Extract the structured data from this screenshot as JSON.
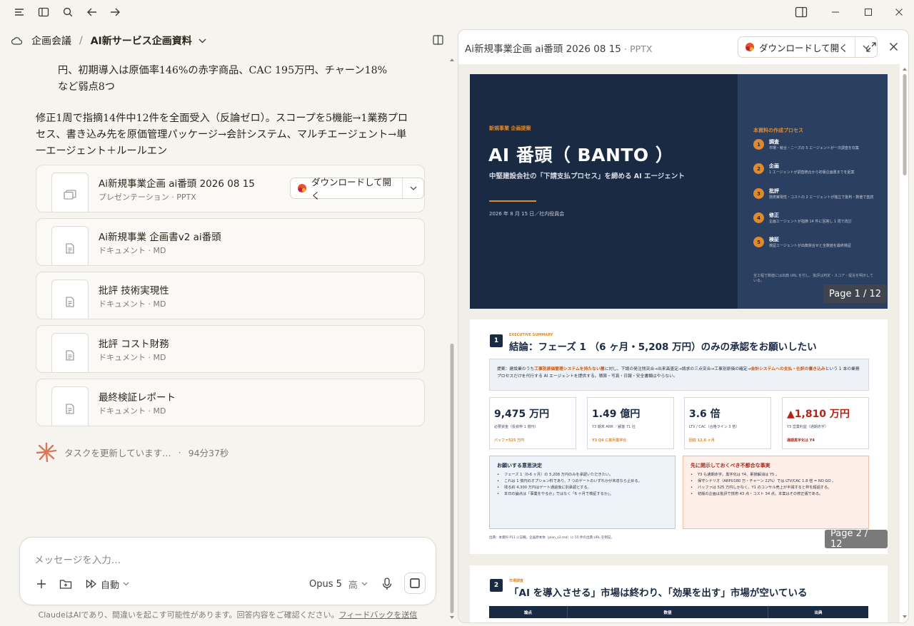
{
  "breadcrumb": {
    "project": "企画会議",
    "separator": "/",
    "current": "AI新サービス企画資料"
  },
  "chat": {
    "partial_line": "円、初期導入は原価率146%の赤字商品、CAC 195万円、チャーン18%",
    "partial_line2": "など弱点8つ",
    "summary": "修正1周で指摘14件中12件を全面受入（反論ゼロ）。スコープを5機能→1業務プロセス、書き込み先を原価管理パッケージ→会計システム、マルチエージェント→単一エージェント＋ルールエン"
  },
  "files": [
    {
      "title": "Ai新規事業企画 ai番頭 2026 08 15",
      "type": "プレゼンテーション · PPTX",
      "icon": "presentation-icon"
    },
    {
      "title": "Ai新規事業 企画書v2 ai番頭",
      "type": "ドキュメント · MD",
      "icon": "document-icon"
    },
    {
      "title": "批評 技術実現性",
      "type": "ドキュメント · MD",
      "icon": "document-icon"
    },
    {
      "title": "批評 コスト財務",
      "type": "ドキュメント · MD",
      "icon": "document-icon"
    },
    {
      "title": "最終検証レポート",
      "type": "ドキュメント · MD",
      "icon": "document-icon"
    }
  ],
  "download_label": "ダウンロードして開く",
  "status": {
    "text": "タスクを更新しています…",
    "sep": "·",
    "elapsed": "94分37秒"
  },
  "composer": {
    "placeholder": "メッセージを入力…",
    "mode": "自動",
    "model": "Opus 5",
    "effort": "高"
  },
  "disclaimer": {
    "text": "ClaudeはAIであり、間違いを起こす可能性があります。回答内容をご確認ください。",
    "link": "フィードバックを送信"
  },
  "preview": {
    "title": "Ai新規事業企画 ai番頭 2026 08 15",
    "ext": "· PPTX",
    "download_label": "ダウンロードして開く",
    "slide1": {
      "kicker": "新規事業 企画提案",
      "title": "AI 番頭（ BANTO ）",
      "subtitle": "中堅建設会社の「下請支払プロセス」を締める AI エージェント",
      "date": "2026 年 8 月 15 日／社内役員会",
      "process_title": "本資料の作成プロセス",
      "steps": [
        {
          "num": "1",
          "title": "調査",
          "desc": "市場・競合・ニーズの 5 エージェントが一次調査を収集"
        },
        {
          "num": "2",
          "title": "企画",
          "desc": "1 エージェントが調査統合から初版企画書までを起案"
        },
        {
          "num": "3",
          "title": "批評",
          "desc": "技術実現性・コストの 2 エージェントが独立で批判・数値で査読"
        },
        {
          "num": "4",
          "title": "修正",
          "desc": "企画エージェントが指摘 14 件に回答し 1 周で改訂"
        },
        {
          "num": "5",
          "title": "検証",
          "desc": "検証エージェントが出典突合せと全数値を最終検証"
        }
      ],
      "footer": "全工程で数値には出典 URL を付し、批評は判定・スコア・提言を明示している。",
      "page": "Page 1 / 12"
    },
    "slide2": {
      "num": "1",
      "kicker": "EXECUTIVE SUMMARY",
      "title": "結論：フェーズ 1 （6 ヶ月・5,208 万円）のみの承認をお願いしたい",
      "lead_a": "提案：建設業のうち",
      "lead_b": "工事別原価管理システムを持たない層",
      "lead_c": "に対し、下請の発注残突合→出来高査定→請求の三点突合→工事別原価の確定→",
      "lead_d": "会計システムへの支払・仕訳の書き込み",
      "lead_e": "という 1 本の業務プロセスだけを代行する AI エージェントを提供する。積算・写真・日報・安全書類はやらない。",
      "kpis": [
        {
          "value": "9,475 万円",
          "label": "必要資金（投資枠 1 億円）",
          "note": "バッファ525 万円",
          "color": "#1b2a43"
        },
        {
          "value": "1.49 億円",
          "label": "Y3 期末 ARR ／顧客 71 社",
          "note": "Y3 Q4 に単月黒字化",
          "color": "#1b2a43"
        },
        {
          "value": "3.6 倍",
          "label": "LTV / CAC（合格ライン 3 倍）",
          "note": "回収 12.6 ヶ月",
          "color": "#1b2a43"
        },
        {
          "value": "▲1,810 万円",
          "label": "Y3 営業利益（通期赤字）",
          "note": "通期黒字化は Y4",
          "color": "#b42318"
        }
      ],
      "decision_title": "お願いする意思決定",
      "decisions": [
        "フェーズ 1（0-6 ヶ月）の 5,208 万円のみを承認いただきたい。",
        "これは 1 億円のオプション料であり、7 つのゲートのいずれかが未達なら止める。",
        "残る約 4,300 万円はゲート通過後に別承認とする。",
        "本日の論点は「事業をやるか」ではなく「6 ヶ月で検証するか」。"
      ],
      "risk_title": "先に開示しておくべき不都合な事実",
      "risks": [
        "Y3 も通期赤字。黒字化は Y4、累損解消は Y5 。",
        "保守シナリオ（ARPU180 万・チャーン 22%）では LTV/CAC 1.8 倍 = NO GO 。",
        "バッファは 525 万円しかなく、Y1 のコンサル売上が半減すると枠を超過する。",
        "初版の企画は批評で技術 43 点・コスト 34 点。本案はその修正版である。"
      ],
      "source": "出典：本資料 P11 に記載。企画原本体（plan_v2.md）に 55 件の出典 URL を明記。",
      "page": "Page 2 / 12"
    },
    "slide3": {
      "num": "2",
      "kicker": "市場調査",
      "title": "「AI を導入させる」市場は終わり、「効果を出す」市場が空いている",
      "cols": [
        "論点",
        "数値",
        "出典"
      ]
    }
  }
}
